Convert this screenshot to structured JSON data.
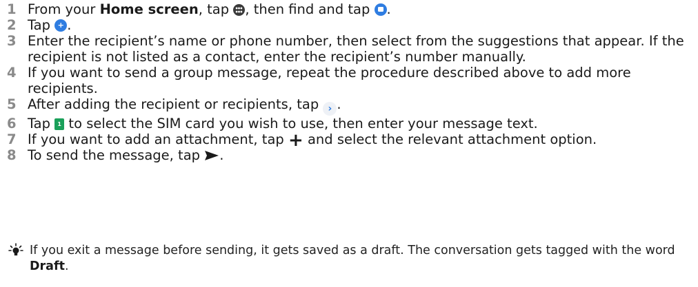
{
  "steps": [
    {
      "number": "1",
      "text_a": "From your ",
      "bold": "Home screen",
      "text_b": ", tap ",
      "text_c": ", then find and tap ",
      "text_d": ".",
      "icons": [
        "apps-icon",
        "messaging-app-icon"
      ]
    },
    {
      "number": "2",
      "text_a": "Tap ",
      "text_b": ".",
      "icons": [
        "new-message-icon"
      ]
    },
    {
      "number": "3",
      "text": "Enter the recipient’s name or phone number, then select from the suggestions that appear. If the recipient is not listed as a contact, enter the recipient’s number manually."
    },
    {
      "number": "4",
      "text": "If you want to send a group message, repeat the procedure described above to add more recipients."
    },
    {
      "number": "5",
      "text_a": "After adding the recipient or recipients, tap ",
      "text_b": ".",
      "icons": [
        "next-arrow-icon"
      ]
    },
    {
      "number": "6",
      "text_a": "Tap ",
      "text_b": " to select the SIM card you wish to use, then enter your message text.",
      "icons": [
        "sim-card-icon"
      ]
    },
    {
      "number": "7",
      "text_a": "If you want to add an attachment, tap ",
      "text_b": " and select the relevant attachment option.",
      "icons": [
        "plus-icon"
      ]
    },
    {
      "number": "8",
      "text_a": "To send the message, tap ",
      "text_b": ".",
      "icons": [
        "send-icon"
      ]
    }
  ],
  "tip": {
    "icon": "lightbulb-icon",
    "text_a": "If you exit a message before sending, it gets saved as a draft. The conversation gets tagged with the word ",
    "bold": "Draft",
    "text_b": "."
  },
  "colors": {
    "step_number": "#8a8a8a",
    "text": "#1a1a1a",
    "icon_blue": "#2f7de1",
    "sim_green": "#1aa05a"
  }
}
